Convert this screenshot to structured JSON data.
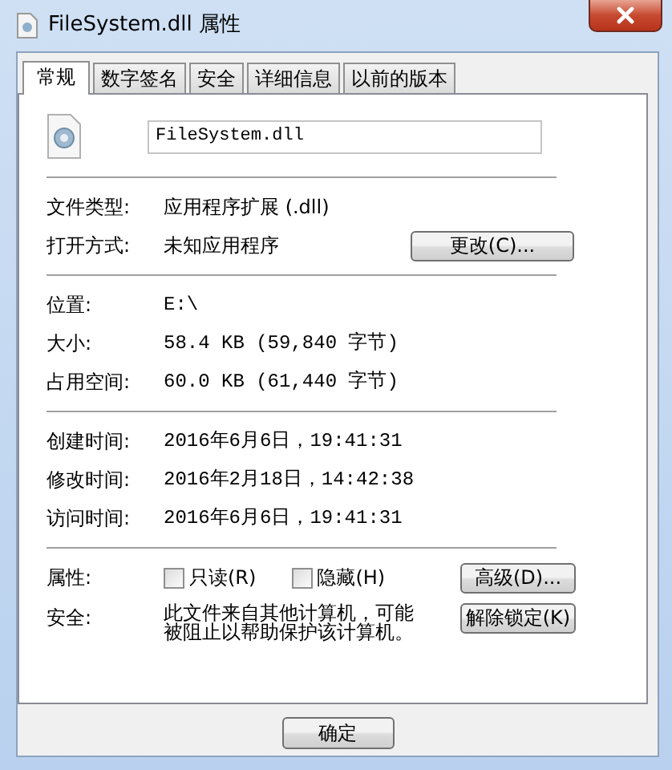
{
  "window": {
    "title": "FileSystem.dll 属性"
  },
  "tabs": [
    {
      "label": "常规",
      "selected": true
    },
    {
      "label": "数字签名",
      "selected": false
    },
    {
      "label": "安全",
      "selected": false
    },
    {
      "label": "详细信息",
      "selected": false
    },
    {
      "label": "以前的版本",
      "selected": false
    }
  ],
  "file_name": "FileSystem.dll",
  "sections": [
    {
      "rows": [
        {
          "kind": "text",
          "label": "文件类型:",
          "value": "应用程序扩展 (.dll)"
        },
        {
          "kind": "text",
          "label": "打开方式:",
          "value": "未知应用程序",
          "button": "更改(C)..."
        }
      ]
    },
    {
      "rows": [
        {
          "kind": "text",
          "label": "位置:",
          "value": "E:\\"
        },
        {
          "kind": "text",
          "label": "大小:",
          "value": "58.4 KB (59,840 字节)"
        },
        {
          "kind": "text",
          "label": "占用空间:",
          "value": "60.0 KB (61,440 字节)"
        }
      ]
    },
    {
      "rows": [
        {
          "kind": "text",
          "label": "创建时间:",
          "value": "2016年6月6日，19:41:31"
        },
        {
          "kind": "text",
          "label": "修改时间:",
          "value": "2016年2月18日，14:42:38"
        },
        {
          "kind": "text",
          "label": "访问时间:",
          "value": "2016年6月6日，19:41:31"
        }
      ]
    },
    {
      "rows": [
        {
          "kind": "checkboxes",
          "label": "属性:",
          "checkboxes": [
            {
              "label": "只读(R)",
              "checked": false
            },
            {
              "label": "隐藏(H)",
              "checked": false
            }
          ],
          "button": "高级(D)..."
        },
        {
          "kind": "note",
          "label": "安全:",
          "value": "此文件来自其他计算机，可能被阻止以帮助保护该计算机。",
          "button": "解除锁定(K)"
        }
      ]
    }
  ],
  "buttons": [
    "确定"
  ]
}
